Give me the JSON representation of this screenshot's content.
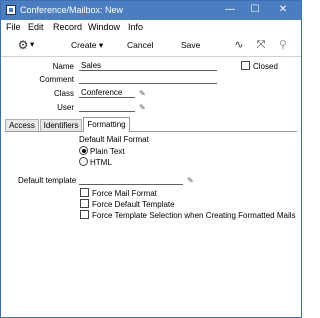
{
  "window": {
    "title": "Conference/Mailbox: New",
    "minimize": "—",
    "maximize": "☐",
    "close": "✕"
  },
  "menu": [
    "File",
    "Edit",
    "Record",
    "Window",
    "Info"
  ],
  "toolbar": {
    "gear_glyph": "⚙",
    "gear_arrow": "▾",
    "create_label": "Create",
    "create_arrow": "▾",
    "cancel_label": "Cancel",
    "save_label": "Save",
    "flag_glyph": "∿",
    "expand_glyph": "⤧",
    "attach_glyph": "⚲"
  },
  "form": {
    "name_label": "Name",
    "name_value": "Sales",
    "comment_label": "Comment",
    "comment_value": "",
    "class_label": "Class",
    "class_value": "Conference",
    "user_label": "User",
    "user_value": "",
    "closed_label": "Closed",
    "closed_checked": false
  },
  "tabs": [
    "Access",
    "Identifiers",
    "Formatting"
  ],
  "active_tab": "Formatting",
  "formatting": {
    "default_mail_format_label": "Default Mail Format",
    "formats": [
      {
        "label": "Plain Text",
        "selected": true
      },
      {
        "label": "HTML",
        "selected": false
      }
    ],
    "default_template_label": "Default template",
    "default_template_value": "",
    "checkboxes": [
      {
        "label": "Force Mail Format",
        "checked": false
      },
      {
        "label": "Force Default Template",
        "checked": false
      },
      {
        "label": "Force Template Selection when Creating Formatted Mails",
        "checked": false
      }
    ]
  },
  "paste_glyph": "✎"
}
